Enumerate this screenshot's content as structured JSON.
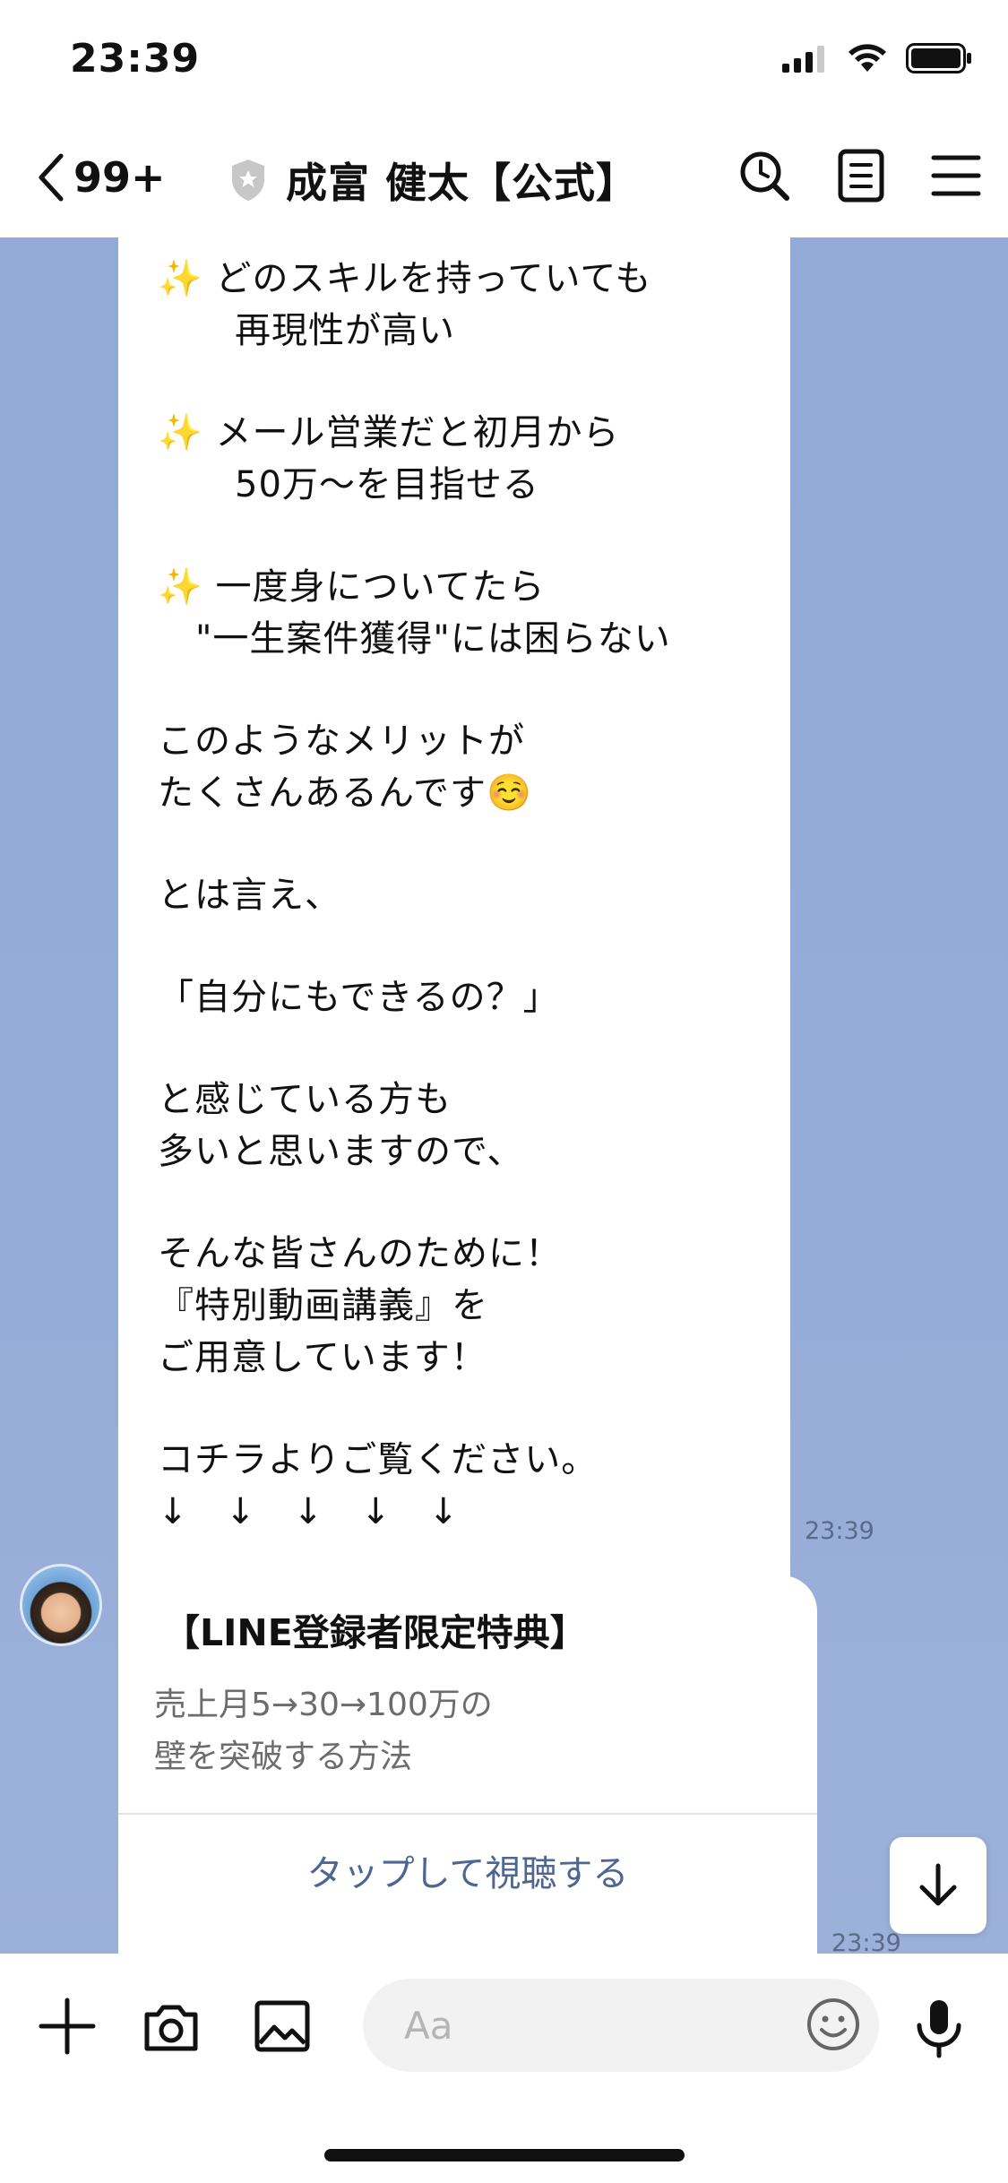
{
  "status_bar": {
    "time": "23:39"
  },
  "header": {
    "back_count": "99+",
    "title": "成富 健太【公式】"
  },
  "messages": {
    "text_lines": [
      "✨ どのスキルを持っていても",
      "再現性が高い",
      "✨ メール営業だと初月から",
      "50万〜を目指せる",
      "✨ 一度身についてたら",
      "\"一生案件獲得\"には困らない",
      "このようなメリットが",
      "たくさんあるんです☺️",
      "とは言え、",
      "「自分にもできるの？」",
      "と感じている方も",
      "多いと思いますので、",
      "そんな皆さんのために！",
      "『特別動画講義』を",
      "ご用意しています！",
      "コチラよりご覧ください。",
      "↓　↓　↓　↓　↓"
    ],
    "text_timestamp": "23:39",
    "card": {
      "title": "【LINE登録者限定特典】",
      "desc_line1": "売上月5→30→100万の",
      "desc_line2": "壁を突破する方法",
      "action": "タップして視聴する",
      "timestamp": "23:39"
    }
  },
  "input": {
    "placeholder": "Aa"
  },
  "colors": {
    "chat_bg": "#94aad6",
    "link": "#4d6693"
  },
  "icons": [
    "back-chevron-icon",
    "shield-icon",
    "search-icon",
    "notes-icon",
    "menu-icon",
    "plus-icon",
    "camera-icon",
    "image-icon",
    "emoji-icon",
    "mic-icon",
    "arrow-down-icon"
  ]
}
